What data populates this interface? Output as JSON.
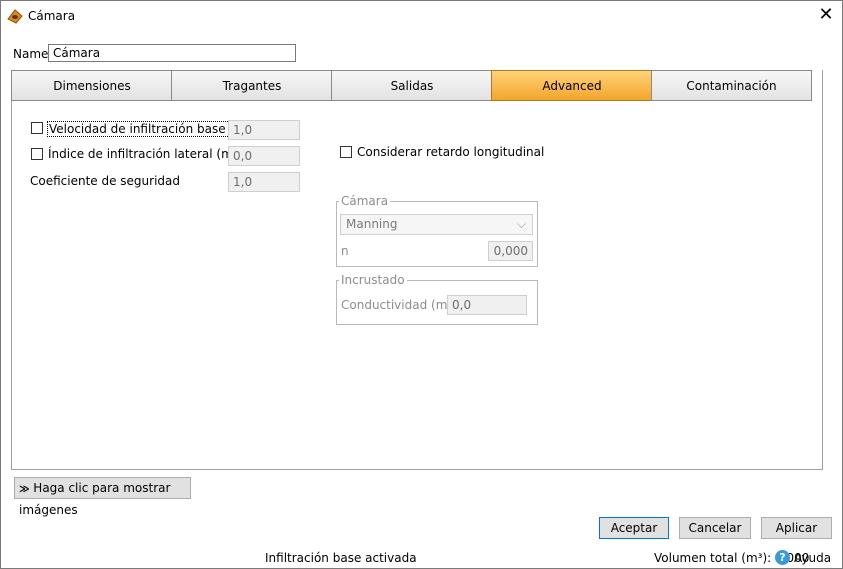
{
  "window": {
    "title": "Cámara"
  },
  "name_field": {
    "label": "Name",
    "value": "Cámara"
  },
  "tabs": [
    {
      "label": "Dimensiones",
      "active": false
    },
    {
      "label": "Tragantes",
      "active": false
    },
    {
      "label": "Salidas",
      "active": false
    },
    {
      "label": "Advanced",
      "active": true
    },
    {
      "label": "Contaminación",
      "active": false
    }
  ],
  "advanced": {
    "velocidad": {
      "label": "Velocidad de infiltración base (m/h)",
      "value": "1,0",
      "checked": false
    },
    "indice": {
      "label": "Índice de infiltración lateral (m/h)",
      "value": "0,0",
      "checked": false
    },
    "coeficiente": {
      "label": "Coeficiente de seguridad",
      "value": "1,0"
    },
    "retardo": {
      "label": "Considerar retardo longitudinal",
      "checked": false
    },
    "camara_group": {
      "title": "Cámara",
      "method": "Manning",
      "n_label": "n",
      "n_value": "0,000"
    },
    "incrustado_group": {
      "title": "Incrustado",
      "cond_label": "Conductividad (m/h)",
      "cond_value": "0,0"
    }
  },
  "images_button": {
    "label": "Haga clic para mostrar imágenes"
  },
  "buttons": {
    "accept": "Aceptar",
    "cancel": "Cancelar",
    "apply": "Aplicar"
  },
  "status_bar": {
    "message": "Infiltración base activada",
    "volume": "Volumen total (m³): 0,000",
    "help": "Ayuda"
  },
  "colors": {
    "active_tab": "#f3a62a",
    "focus_border": "#0078d7"
  },
  "icons": {
    "app": "manhole-chamber-icon",
    "close": "close-icon",
    "expand": "double-chevron-down-icon",
    "help": "help-circle-icon",
    "dropdown": "chevron-down-icon"
  }
}
